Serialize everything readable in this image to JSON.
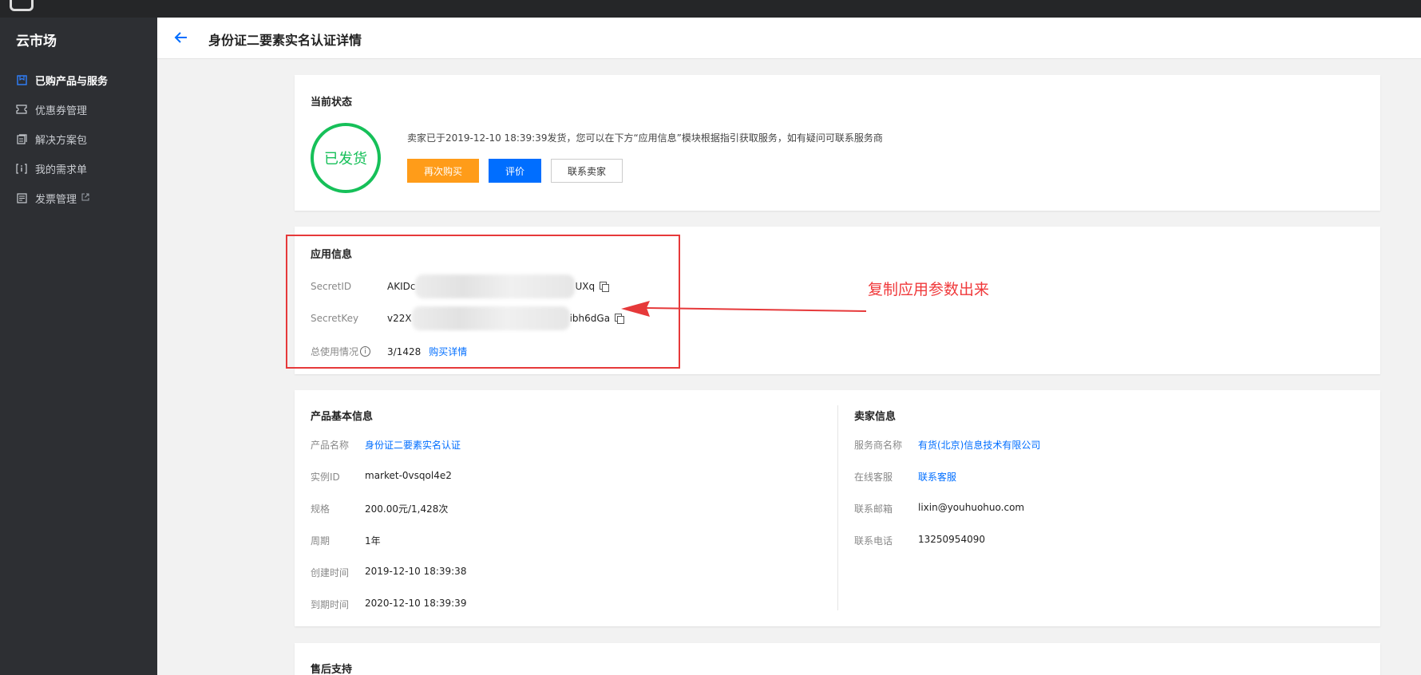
{
  "sidebar": {
    "brand": "云市场",
    "items": [
      {
        "label": "已购产品与服务",
        "icon": "bookmark-icon",
        "active": true
      },
      {
        "label": "优惠券管理",
        "icon": "ticket-icon"
      },
      {
        "label": "解决方案包",
        "icon": "package-icon"
      },
      {
        "label": "我的需求单",
        "icon": "info-bracket-icon"
      },
      {
        "label": "发票管理",
        "icon": "invoice-icon",
        "external": true
      }
    ]
  },
  "header": {
    "title": "身份证二要素实名认证详情",
    "back_icon": "arrow-left-icon"
  },
  "status": {
    "section_title": "当前状态",
    "badge": "已发货",
    "message": "卖家已于2019-12-10 18:39:39发货，您可以在下方“应用信息”模块根据指引获取服务，如有疑问可联系服务商",
    "buttons": {
      "rebuy": "再次购买",
      "review": "评价",
      "contact": "联系卖家"
    }
  },
  "app_info": {
    "section_title": "应用信息",
    "secret_id_label": "SecretID",
    "secret_id_prefix": "AKIDc",
    "secret_id_suffix": "UXq",
    "secret_key_label": "SecretKey",
    "secret_key_prefix": "v22X",
    "secret_key_suffix": "ibh6dGa",
    "usage_label": "总使用情况",
    "usage_value": "3/1428",
    "usage_link": "购买详情"
  },
  "annotation": "复制应用参数出来",
  "product": {
    "section_title": "产品基本信息",
    "name_label": "产品名称",
    "name_value": "身份证二要素实名认证",
    "instance_label": "实例ID",
    "instance_value": "market-0vsqol4e2",
    "spec_label": "规格",
    "spec_value": "200.00元/1,428次",
    "period_label": "周期",
    "period_value": "1年",
    "created_label": "创建时间",
    "created_value": "2019-12-10 18:39:38",
    "expire_label": "到期时间",
    "expire_value": "2020-12-10 18:39:39"
  },
  "seller": {
    "section_title": "卖家信息",
    "provider_label": "服务商名称",
    "provider_value": "有货(北京)信息技术有限公司",
    "service_label": "在线客服",
    "service_value": "联系客服",
    "email_label": "联系邮箱",
    "email_value": "lixin@youhuohuo.com",
    "phone_label": "联系电话",
    "phone_value": "13250954090"
  },
  "aftersales": {
    "section_title": "售后支持"
  },
  "colors": {
    "accent": "#006eff",
    "success": "#16c059",
    "warning": "#ff9c19",
    "annotation": "#e6393a"
  }
}
